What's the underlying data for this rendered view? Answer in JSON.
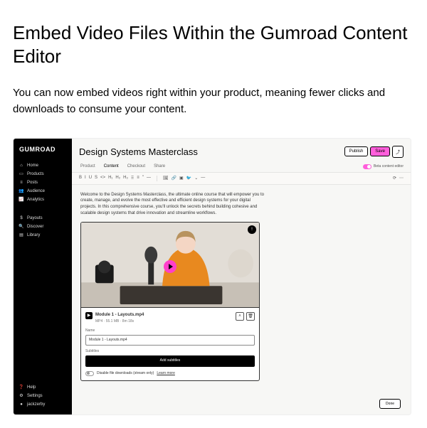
{
  "article": {
    "title": "Embed Video Files Within the Gumroad Content Editor",
    "body": "You can now embed videos right within your product, meaning fewer clicks and downloads to consume your content."
  },
  "app": {
    "logo": "GUMROAD",
    "nav_primary": [
      {
        "label": "Home",
        "glyph": "⌂"
      },
      {
        "label": "Products",
        "glyph": "▭"
      },
      {
        "label": "Posts",
        "glyph": "≡"
      },
      {
        "label": "Audience",
        "glyph": "👥"
      },
      {
        "label": "Analytics",
        "glyph": "📈"
      }
    ],
    "nav_secondary": [
      {
        "label": "Payouts",
        "glyph": "$"
      },
      {
        "label": "Discover",
        "glyph": "🔍"
      },
      {
        "label": "Library",
        "glyph": "▤"
      }
    ],
    "nav_footer": [
      {
        "label": "Help",
        "glyph": "❓"
      },
      {
        "label": "Settings",
        "glyph": "⚙"
      },
      {
        "label": "jackzerby",
        "glyph": "●"
      }
    ]
  },
  "editor": {
    "title": "Design Systems Masterclass",
    "actions": {
      "publish": "Publish",
      "save": "Save",
      "export": "⤴"
    },
    "tabs": [
      "Product",
      "Content",
      "Checkout",
      "Share"
    ],
    "beta_label": "Beta content editor",
    "toolbar": {
      "format": [
        "B",
        "I",
        "U",
        "S",
        "<>",
        "H₁",
        "H₂",
        "H₃",
        "⠿",
        "≡",
        "\"",
        "—"
      ],
      "insert": [
        "🖼",
        "🔗",
        "▣",
        "🐦",
        "⌄",
        "—"
      ],
      "right": [
        "⟳",
        "⋯"
      ]
    },
    "intro": "Welcome to the Design Systems Masterclass, the ultimate online course that will empower you to create, manage, and evolve the most effective and efficient design systems for your digital projects. In this comprehensive course, you'll unlock the secrets behind building cohesive and scalable design systems that drive innovation and streamline workflows.",
    "video": {
      "filename": "Module 1 - Layouts.mp4",
      "meta": "MP4 · 55.1 MB · 8m 18s",
      "name_label": "Name",
      "name_value": "Module 1 - Layouts.mp4",
      "subtitles_label": "Subtitles",
      "add_subtitles": "Add subtitles",
      "disable_download": "Disable file downloads (stream only)",
      "learn_more": "Learn more",
      "done": "Done"
    }
  }
}
